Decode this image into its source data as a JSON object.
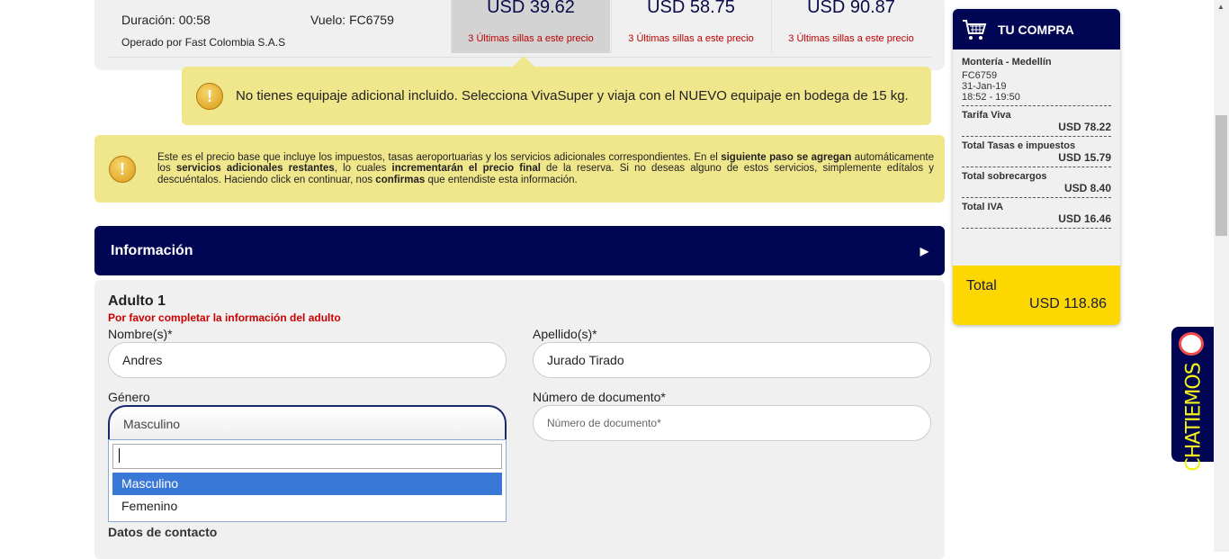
{
  "flight": {
    "duration": "Duración: 00:58",
    "flight": "Vuelo: FC6759",
    "operator": "Operado por Fast Colombia S.A.S",
    "fares": [
      {
        "price": "USD 39.62",
        "seats": "3 Últimas sillas a este precio",
        "selected": true
      },
      {
        "price": "USD 58.75",
        "seats": "3 Últimas sillas a este precio"
      },
      {
        "price": "USD 90.87",
        "seats": "3 Últimas sillas a este precio"
      }
    ]
  },
  "tooltip": "No tienes equipaje adicional incluido. Selecciona VivaSuper y viaja con el NUEVO equipaje en bodega de 15 kg.",
  "notice": {
    "t1": "Este es el precio base que incluye los impuestos, tasas aeroportuarias y los servicios adicionales correspondientes. En el ",
    "b1": "siguiente paso se agregan",
    "t2": " automáticamente los ",
    "b2": "servicios adicionales restantes",
    "t3": ", lo cuales ",
    "b3": "incrementarán el precio final",
    "t4": " de la reserva. Si no deseas alguno de estos servicios, simplemente edítalos y descuéntalos. Haciendo click en continuar, nos ",
    "b4": "confirmas",
    "t5": " que entendiste esta información."
  },
  "section": {
    "title": "Información",
    "arrow": "▶"
  },
  "form": {
    "adult": "Adulto 1",
    "warning": "Por favor completar la información del adulto",
    "name_label": "Nombre(s)*",
    "name_value": "Andres",
    "surname_label": "Apellido(s)*",
    "surname_value": "Jurado Tirado",
    "gender_label": "Género",
    "gender_value": "Masculino",
    "doc_label": "Número de documento*",
    "doc_placeholder": "Número de documento*",
    "gender_options": [
      "Masculino",
      "Femenino"
    ],
    "contact": "Datos de contacto"
  },
  "cart": {
    "title": "TU COMPRA",
    "route": "Montería - Medellín",
    "flight": "FC6759",
    "date": "31-Jan-19",
    "time": "18:52 - 19:50",
    "items": [
      {
        "label": "Tarifa Viva",
        "value": "USD 78.22"
      },
      {
        "label": "Total Tasas e impuestos",
        "value": "USD 15.79"
      },
      {
        "label": "Total sobrecargos",
        "value": "USD 8.40"
      },
      {
        "label": "Total IVA",
        "value": "USD 16.46"
      }
    ],
    "total_label": "Total",
    "total_value": "USD 118.86"
  },
  "chat": {
    "label": "CHATIEMOS"
  },
  "colors": {
    "navy": "#000654",
    "yellow": "#fdd800",
    "notice": "#f0e68c",
    "highlight": "#3a78d8"
  }
}
